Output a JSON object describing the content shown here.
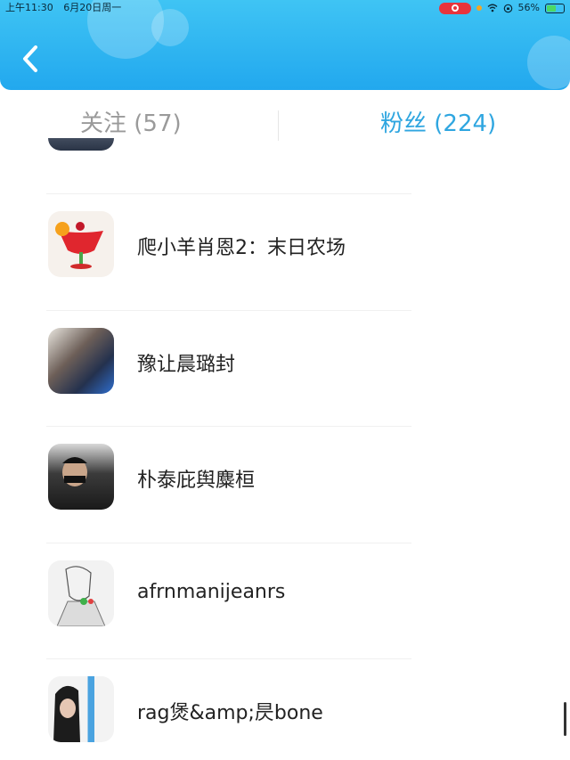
{
  "status_bar": {
    "time": "上午11:30",
    "date": "6月20日周一",
    "battery": "56%"
  },
  "header": {
    "back_icon": "chevron-left-icon"
  },
  "tabs": [
    {
      "label": "关注 (57)",
      "active": false
    },
    {
      "label": "粉丝 (224)",
      "active": true
    }
  ],
  "fans": [
    {
      "name": "爬小羊肖恩2：末日农场"
    },
    {
      "name": "豫让晨璐封"
    },
    {
      "name": "朴泰庇舆麋桓"
    },
    {
      "name": "afrnmanijeanrs"
    },
    {
      "name": "rag煲&amp;昃bone"
    }
  ],
  "colors": {
    "header": "#27aef0",
    "active_tab": "#2fa6e0",
    "inactive_tab": "#9a9a9a"
  }
}
